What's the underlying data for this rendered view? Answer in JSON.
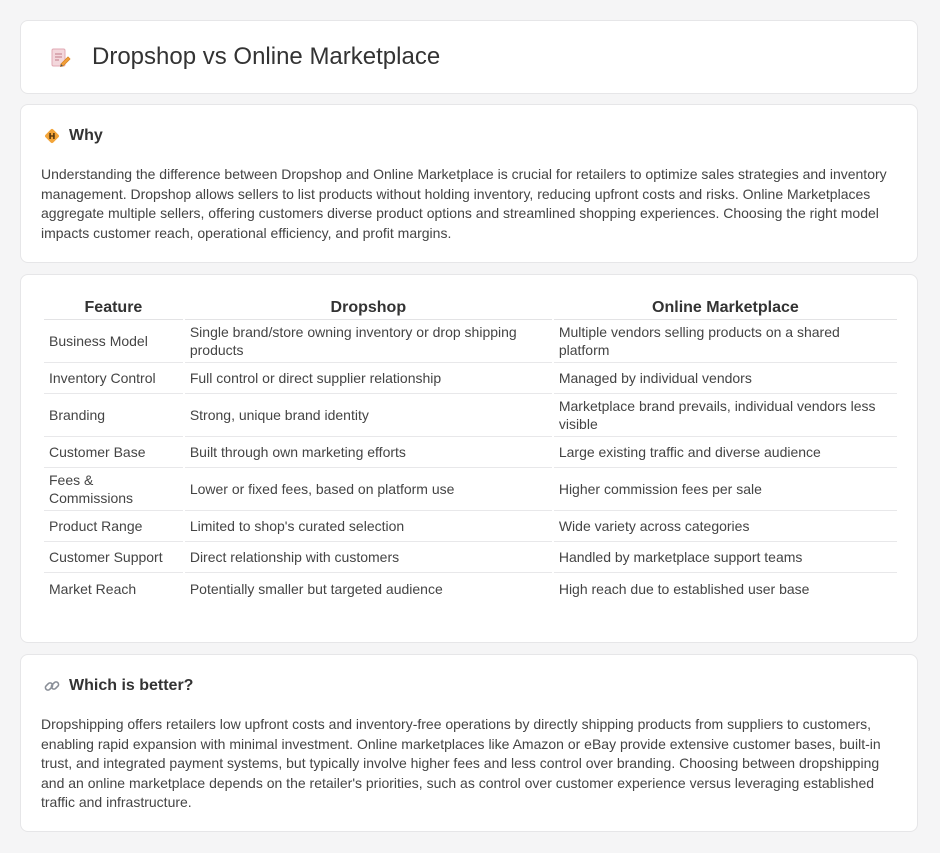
{
  "header": {
    "title": "Dropshop vs Online Marketplace",
    "icon": "document-edit-icon"
  },
  "why": {
    "heading": "Why",
    "icon": "diamond-warning-icon",
    "body": "Understanding the difference between Dropshop and Online Marketplace is crucial for retailers to optimize sales strategies and inventory management. Dropshop allows sellers to list products without holding inventory, reducing upfront costs and risks. Online Marketplaces aggregate multiple sellers, offering customers diverse product options and streamlined shopping experiences. Choosing the right model impacts customer reach, operational efficiency, and profit margins."
  },
  "table": {
    "columns": [
      "Feature",
      "Dropshop",
      "Online Marketplace"
    ],
    "rows": [
      [
        "Business Model",
        "Single brand/store owning inventory or drop shipping products",
        "Multiple vendors selling products on a shared platform"
      ],
      [
        "Inventory Control",
        "Full control or direct supplier relationship",
        "Managed by individual vendors"
      ],
      [
        "Branding",
        "Strong, unique brand identity",
        "Marketplace brand prevails, individual vendors less visible"
      ],
      [
        "Customer Base",
        "Built through own marketing efforts",
        "Large existing traffic and diverse audience"
      ],
      [
        "Fees & Commissions",
        "Lower or fixed fees, based on platform use",
        "Higher commission fees per sale"
      ],
      [
        "Product Range",
        "Limited to shop's curated selection",
        "Wide variety across categories"
      ],
      [
        "Customer Support",
        "Direct relationship with customers",
        "Handled by marketplace support teams"
      ],
      [
        "Market Reach",
        "Potentially smaller but targeted audience",
        "High reach due to established user base"
      ]
    ]
  },
  "better": {
    "heading": "Which is better?",
    "icon": "link-icon",
    "body": "Dropshipping offers retailers low upfront costs and inventory-free operations by directly shipping products from suppliers to customers, enabling rapid expansion with minimal investment. Online marketplaces like Amazon or eBay provide extensive customer bases, built-in trust, and integrated payment systems, but typically involve higher fees and less control over branding. Choosing between dropshipping and an online marketplace depends on the retailer's priorities, such as control over customer experience versus leveraging established traffic and infrastructure."
  },
  "colors": {
    "background": "#f5f5f6",
    "card": "#ffffff",
    "border": "#e6e6e8",
    "accent_orange": "#f0a030"
  }
}
